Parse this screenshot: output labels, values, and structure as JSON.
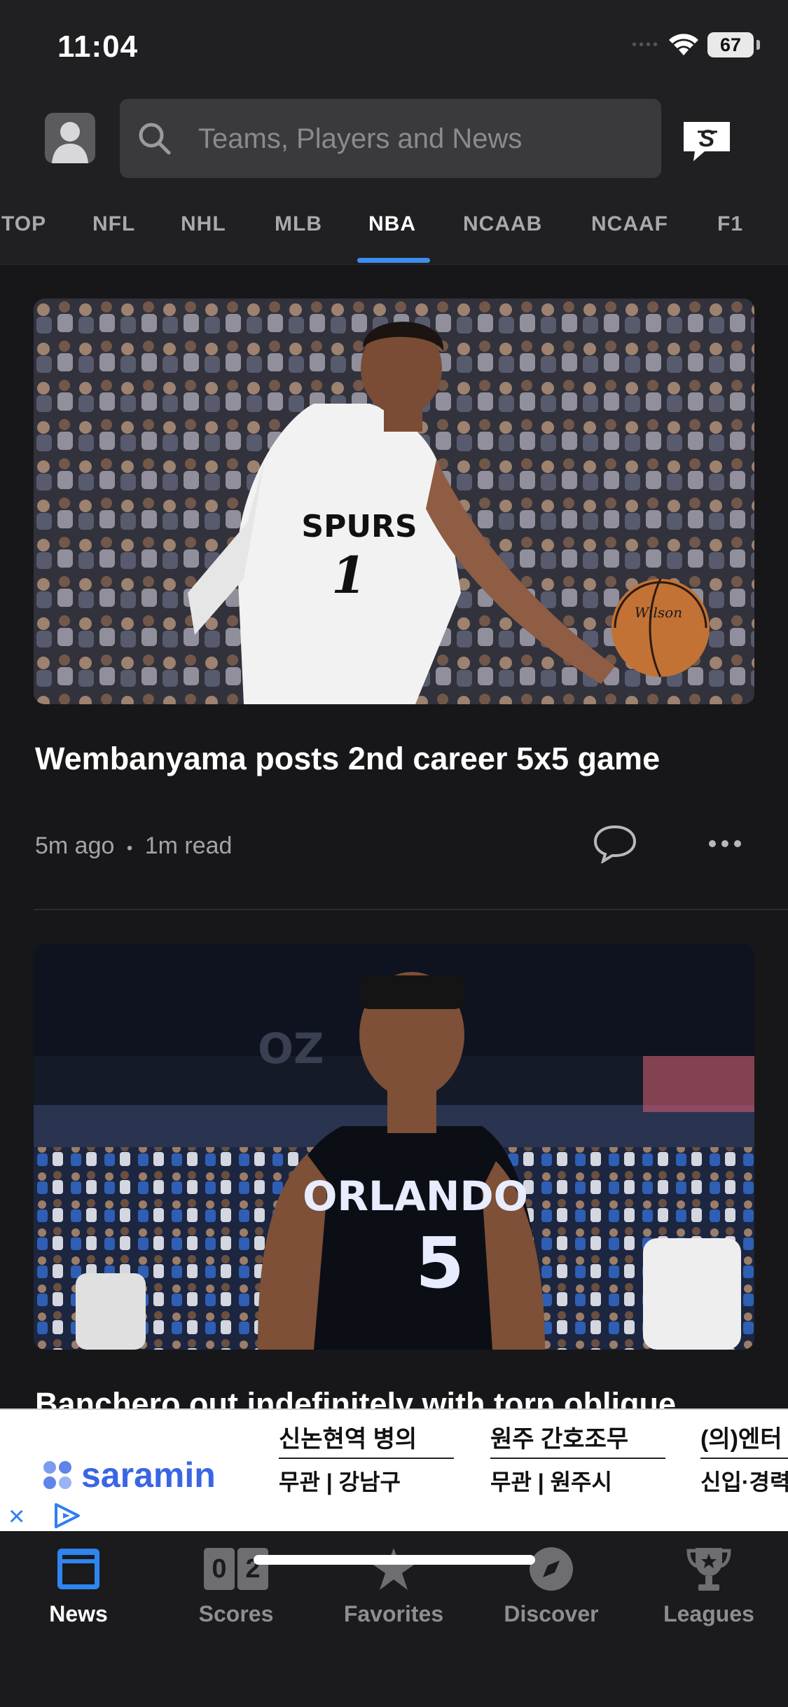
{
  "status": {
    "time": "11:04",
    "battery": "67"
  },
  "search": {
    "placeholder": "Teams, Players and News"
  },
  "tabs": [
    "TOP",
    "NFL",
    "NHL",
    "MLB",
    "NBA",
    "NCAAB",
    "NCAAF",
    "F1"
  ],
  "active_tab": "NBA",
  "articles": [
    {
      "headline": "Wembanyama posts 2nd career 5x5 game",
      "age": "5m ago",
      "read_time": "1m read",
      "separator": "•",
      "image": {
        "jersey_team": "SPURS",
        "jersey_number": "1",
        "ball_brand": "Wilson"
      }
    },
    {
      "headline": "Banchero out indefinitely with torn oblique",
      "image": {
        "jersey_team": "ORLANDO",
        "jersey_number": "5",
        "arena_text": "OZ"
      }
    }
  ],
  "ad": {
    "brand": "saramin",
    "listings": [
      {
        "title": "신논현역 병의",
        "detail": "무관 | 강남구"
      },
      {
        "title": "원주 간호조무",
        "detail": "무관 | 원주시"
      },
      {
        "title": "(의)엔터의",
        "detail": "신입·경력"
      }
    ],
    "close_icon": "×"
  },
  "bottom_nav": [
    {
      "label": "News",
      "icon": "news-icon",
      "active": true
    },
    {
      "label": "Scores",
      "icon": "scores-icon",
      "digits": [
        "0",
        "2"
      ]
    },
    {
      "label": "Favorites",
      "icon": "star-icon"
    },
    {
      "label": "Discover",
      "icon": "compass-icon"
    },
    {
      "label": "Leagues",
      "icon": "trophy-icon"
    }
  ],
  "colors": {
    "accent": "#3b8ff0",
    "background": "#17171a",
    "ad_brand": "#3a66e3"
  }
}
